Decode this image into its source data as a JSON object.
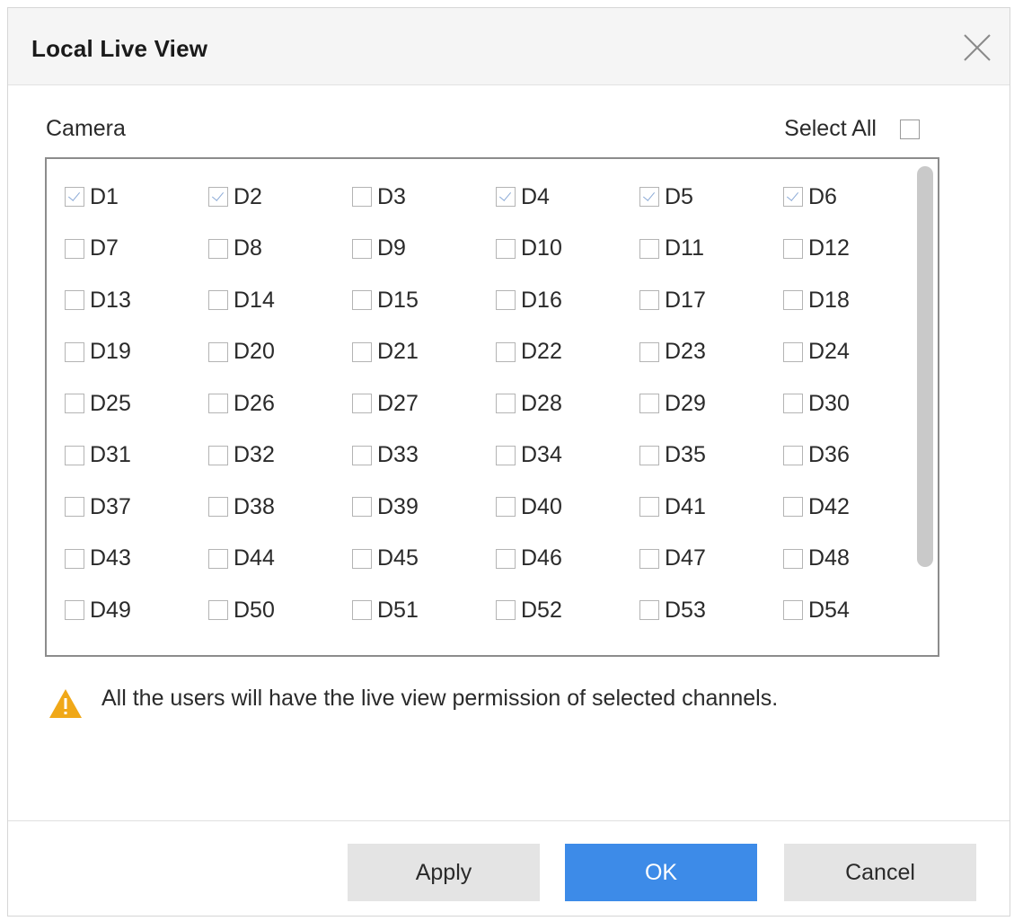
{
  "dialog": {
    "title": "Local Live View",
    "close_icon": "close-icon"
  },
  "camera_section": {
    "label": "Camera",
    "select_all_label": "Select All",
    "select_all_checked": false
  },
  "channels": [
    {
      "label": "D1",
      "checked": true
    },
    {
      "label": "D2",
      "checked": true
    },
    {
      "label": "D3",
      "checked": false
    },
    {
      "label": "D4",
      "checked": true
    },
    {
      "label": "D5",
      "checked": true
    },
    {
      "label": "D6",
      "checked": true
    },
    {
      "label": "D7",
      "checked": false
    },
    {
      "label": "D8",
      "checked": false
    },
    {
      "label": "D9",
      "checked": false
    },
    {
      "label": "D10",
      "checked": false
    },
    {
      "label": "D11",
      "checked": false
    },
    {
      "label": "D12",
      "checked": false
    },
    {
      "label": "D13",
      "checked": false
    },
    {
      "label": "D14",
      "checked": false
    },
    {
      "label": "D15",
      "checked": false
    },
    {
      "label": "D16",
      "checked": false
    },
    {
      "label": "D17",
      "checked": false
    },
    {
      "label": "D18",
      "checked": false
    },
    {
      "label": "D19",
      "checked": false
    },
    {
      "label": "D20",
      "checked": false
    },
    {
      "label": "D21",
      "checked": false
    },
    {
      "label": "D22",
      "checked": false
    },
    {
      "label": "D23",
      "checked": false
    },
    {
      "label": "D24",
      "checked": false
    },
    {
      "label": "D25",
      "checked": false
    },
    {
      "label": "D26",
      "checked": false
    },
    {
      "label": "D27",
      "checked": false
    },
    {
      "label": "D28",
      "checked": false
    },
    {
      "label": "D29",
      "checked": false
    },
    {
      "label": "D30",
      "checked": false
    },
    {
      "label": "D31",
      "checked": false
    },
    {
      "label": "D32",
      "checked": false
    },
    {
      "label": "D33",
      "checked": false
    },
    {
      "label": "D34",
      "checked": false
    },
    {
      "label": "D35",
      "checked": false
    },
    {
      "label": "D36",
      "checked": false
    },
    {
      "label": "D37",
      "checked": false
    },
    {
      "label": "D38",
      "checked": false
    },
    {
      "label": "D39",
      "checked": false
    },
    {
      "label": "D40",
      "checked": false
    },
    {
      "label": "D41",
      "checked": false
    },
    {
      "label": "D42",
      "checked": false
    },
    {
      "label": "D43",
      "checked": false
    },
    {
      "label": "D44",
      "checked": false
    },
    {
      "label": "D45",
      "checked": false
    },
    {
      "label": "D46",
      "checked": false
    },
    {
      "label": "D47",
      "checked": false
    },
    {
      "label": "D48",
      "checked": false
    },
    {
      "label": "D49",
      "checked": false
    },
    {
      "label": "D50",
      "checked": false
    },
    {
      "label": "D51",
      "checked": false
    },
    {
      "label": "D52",
      "checked": false
    },
    {
      "label": "D53",
      "checked": false
    },
    {
      "label": "D54",
      "checked": false
    }
  ],
  "notice": {
    "icon": "warning-icon",
    "text": "All the users will have the live view permission of selected channels."
  },
  "buttons": {
    "apply_label": "Apply",
    "ok_label": "OK",
    "cancel_label": "Cancel"
  },
  "colors": {
    "primary": "#3d8be8",
    "secondary_button": "#e4e4e4",
    "warning": "#f0a818",
    "checkmark": "#8aa9d6"
  }
}
